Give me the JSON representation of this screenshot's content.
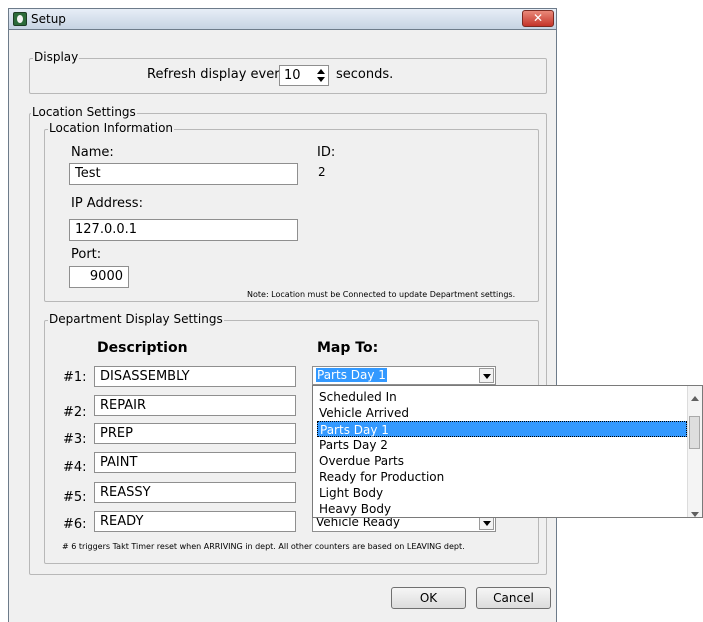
{
  "window": {
    "title": "Setup",
    "close_label": "✕"
  },
  "display": {
    "legend": "Display",
    "refresh_prefix": "Refresh display every",
    "refresh_value": "10",
    "refresh_suffix": "seconds."
  },
  "location_settings": {
    "legend": "Location Settings",
    "info": {
      "legend": "Location Information",
      "name_label": "Name:",
      "name_value": "Test",
      "id_label": "ID:",
      "id_value": "2",
      "ip_label": "IP Address:",
      "ip_value": "127.0.0.1",
      "port_label": "Port:",
      "port_value": "9000",
      "note": "Note: Location must be Connected to update Department settings."
    },
    "departments": {
      "legend": "Department Display Settings",
      "description_header": "Description",
      "map_to_header": "Map To:",
      "rows": [
        {
          "num": "#1:",
          "description": "DISASSEMBLY",
          "map_to": "Parts Day 1"
        },
        {
          "num": "#2:",
          "description": "REPAIR",
          "map_to": ""
        },
        {
          "num": "#3:",
          "description": "PREP",
          "map_to": ""
        },
        {
          "num": "#4:",
          "description": "PAINT",
          "map_to": ""
        },
        {
          "num": "#5:",
          "description": "REASSY",
          "map_to": ""
        },
        {
          "num": "#6:",
          "description": "READY",
          "map_to": "Vehicle Ready"
        }
      ],
      "note": "# 6 triggers Takt Timer reset when ARRIVING in dept.  All other counters are based on LEAVING dept."
    }
  },
  "dropdown": {
    "options": [
      "Scheduled In",
      "Vehicle Arrived",
      "Parts Day 1",
      "Parts Day 2",
      "Overdue Parts",
      "Ready for Production",
      "Light Body",
      "Heavy Body"
    ],
    "selected": "Parts Day 1"
  },
  "buttons": {
    "ok": "OK",
    "cancel": "Cancel"
  },
  "colors": {
    "selection": "#3399ff",
    "close_button": "#c4342a"
  }
}
